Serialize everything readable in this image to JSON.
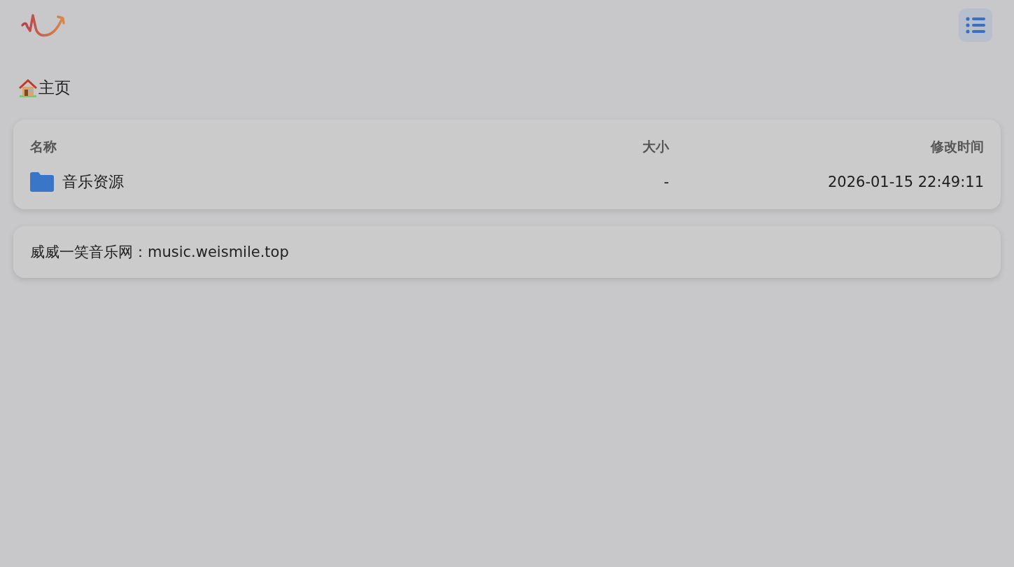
{
  "breadcrumb": {
    "label": "主页"
  },
  "table": {
    "columns": [
      "名称",
      "大小",
      "修改时间"
    ],
    "rows": [
      {
        "kind": "folder",
        "name": "音乐资源",
        "size": "-",
        "modified": "2026-01-15 22:49:11"
      }
    ]
  },
  "footer_note": {
    "label": "威威一笑音乐网：",
    "link": "music.weismile.top"
  }
}
